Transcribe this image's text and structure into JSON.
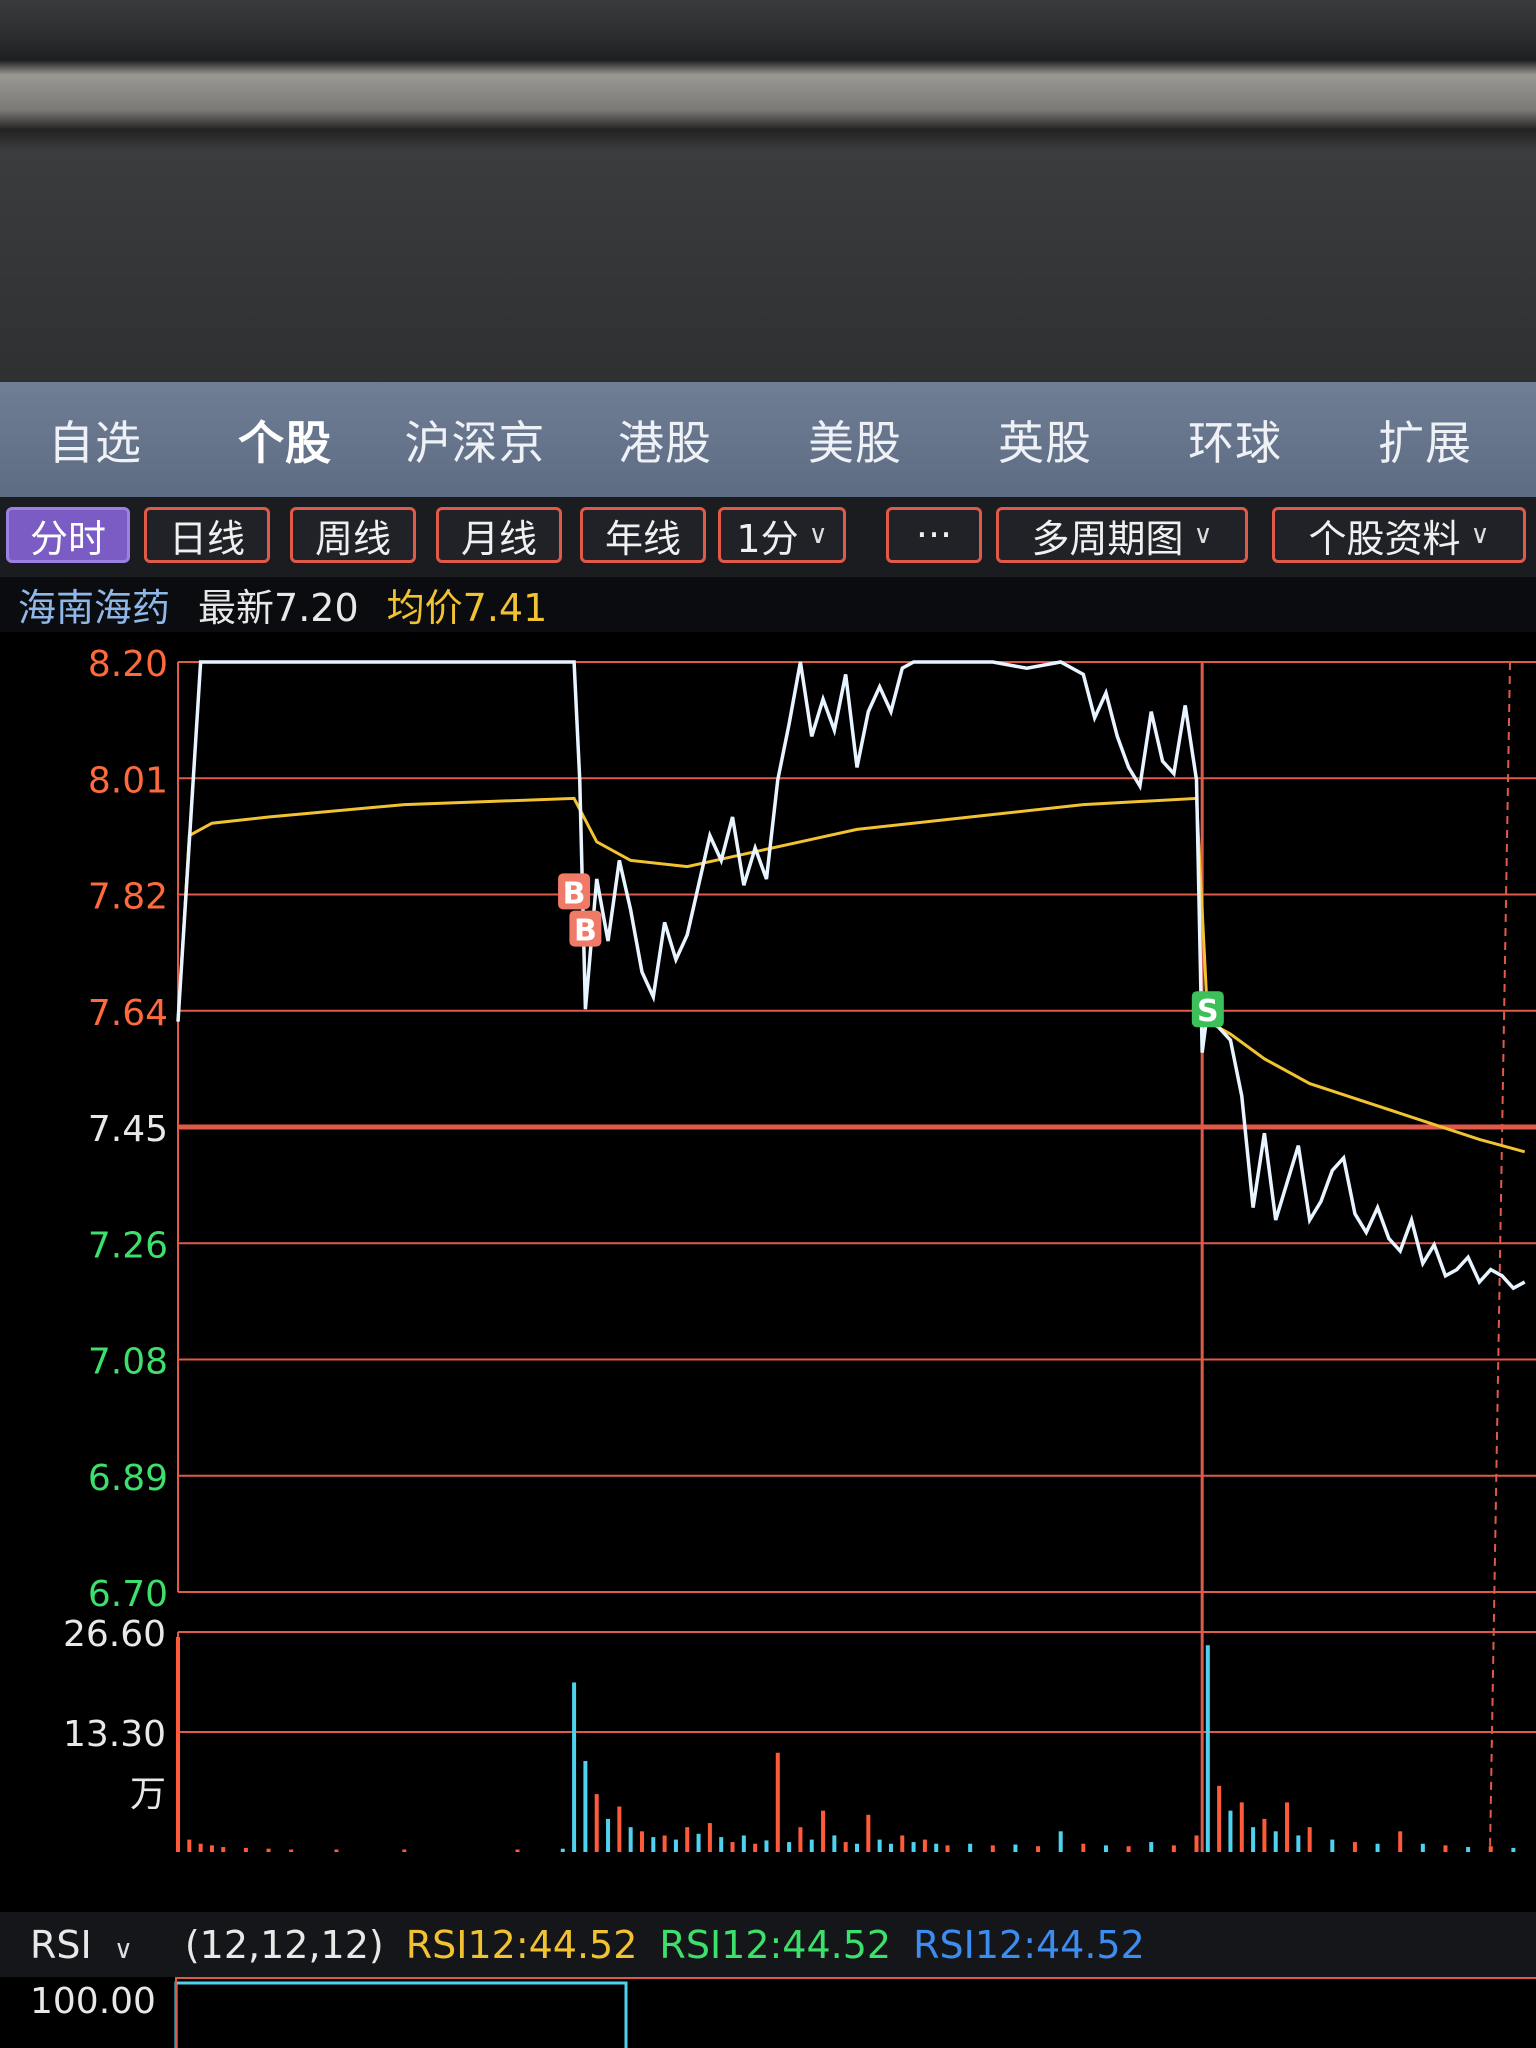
{
  "nav": {
    "tabs": [
      "自选",
      "个股",
      "沪深京",
      "港股",
      "美股",
      "英股",
      "环球",
      "扩展"
    ],
    "active_index": 1
  },
  "toolbar": {
    "buttons": [
      "分时",
      "日线",
      "周线",
      "月线",
      "年线",
      "1分",
      "···",
      "多周期图",
      "个股资料"
    ],
    "active_index": 0
  },
  "info": {
    "name": "海南海药",
    "latest": "最新7.20",
    "avg": "均价7.41"
  },
  "colors": {
    "up": "#ff6a3d",
    "down": "#3de06a",
    "price_line": "#e8f4ff",
    "avg_line": "#f1c232",
    "grid": "#e05a4a",
    "vol_up": "#ff5a3a",
    "vol_down": "#4fd2f0"
  },
  "chart_data": {
    "type": "line",
    "price_axis": {
      "ticks": [
        "8.20",
        "8.01",
        "7.82",
        "7.64",
        "7.45",
        "7.26",
        "7.08",
        "6.89",
        "6.70"
      ],
      "ylim": [
        6.7,
        8.2
      ]
    },
    "volume_axis": {
      "ticks": [
        "26.60",
        "13.30",
        "万"
      ],
      "ylim": [
        0,
        26.6
      ]
    },
    "series": [
      {
        "x": [
          0,
          2,
          4,
          6,
          18,
          35,
          35.5,
          36,
          37,
          38,
          39,
          40,
          41,
          42,
          43,
          44,
          45,
          46,
          47,
          48,
          49,
          50,
          51,
          52,
          53,
          54,
          55,
          56,
          57,
          58,
          59,
          60,
          61,
          62,
          63,
          64,
          65,
          66,
          67,
          68,
          69,
          70,
          72,
          75,
          78,
          80,
          81,
          82,
          83,
          84,
          85,
          86,
          87,
          88,
          89,
          90,
          90.5,
          91,
          92,
          93,
          94,
          95,
          96,
          97,
          98,
          99,
          100,
          101,
          102,
          103,
          104,
          105,
          106,
          107,
          108,
          109,
          110,
          111,
          112,
          113,
          114,
          115,
          116,
          117,
          118,
          119
        ],
        "values": [
          7.62,
          8.2,
          8.2,
          8.2,
          8.2,
          8.2,
          8.01,
          7.64,
          7.85,
          7.75,
          7.88,
          7.8,
          7.7,
          7.66,
          7.78,
          7.72,
          7.76,
          7.84,
          7.92,
          7.88,
          7.95,
          7.84,
          7.9,
          7.85,
          8.01,
          8.1,
          8.2,
          8.08,
          8.14,
          8.09,
          8.18,
          8.03,
          8.12,
          8.16,
          8.12,
          8.19,
          8.2,
          8.2,
          8.2,
          8.2,
          8.2,
          8.2,
          8.2,
          8.19,
          8.2,
          8.18,
          8.11,
          8.15,
          8.08,
          8.03,
          8.0,
          8.12,
          8.04,
          8.02,
          8.13,
          8.01,
          7.57,
          7.64,
          7.61,
          7.59,
          7.5,
          7.32,
          7.44,
          7.3,
          7.36,
          7.42,
          7.3,
          7.33,
          7.38,
          7.4,
          7.31,
          7.28,
          7.32,
          7.27,
          7.25,
          7.3,
          7.23,
          7.26,
          7.21,
          7.22,
          7.24,
          7.2,
          7.22,
          7.21,
          7.19,
          7.2
        ]
      },
      {
        "x": [
          0,
          1,
          3,
          8,
          20,
          35,
          37,
          40,
          45,
          50,
          55,
          60,
          70,
          80,
          90,
          91,
          93,
          96,
          100,
          105,
          110,
          115,
          119
        ],
        "values": [
          7.62,
          7.92,
          7.94,
          7.95,
          7.97,
          7.98,
          7.91,
          7.88,
          7.87,
          7.89,
          7.91,
          7.93,
          7.95,
          7.97,
          7.98,
          7.62,
          7.6,
          7.56,
          7.52,
          7.49,
          7.46,
          7.43,
          7.41
        ]
      }
    ],
    "markers": [
      {
        "label": "B",
        "x": 35,
        "value": 7.83,
        "color": "#f07a68"
      },
      {
        "label": "B",
        "x": 36,
        "value": 7.77,
        "color": "#f07a68"
      },
      {
        "label": "S",
        "x": 91,
        "value": 7.64,
        "color": "#3dbf5a"
      }
    ],
    "volume": {
      "x": [
        0,
        1,
        2,
        3,
        4,
        6,
        8,
        10,
        14,
        20,
        30,
        34,
        35,
        36,
        37,
        38,
        39,
        40,
        41,
        42,
        43,
        44,
        45,
        46,
        47,
        48,
        49,
        50,
        51,
        52,
        53,
        54,
        55,
        56,
        57,
        58,
        59,
        60,
        61,
        62,
        63,
        64,
        65,
        66,
        67,
        68,
        70,
        72,
        74,
        76,
        78,
        80,
        82,
        84,
        86,
        88,
        90,
        91,
        92,
        93,
        94,
        95,
        96,
        97,
        98,
        99,
        100,
        102,
        104,
        106,
        108,
        110,
        112,
        114,
        116,
        118
      ],
      "values": [
        26.0,
        1.5,
        1.0,
        0.8,
        0.6,
        0.5,
        0.4,
        0.3,
        0.3,
        0.3,
        0.3,
        0.4,
        20.5,
        11.0,
        7.0,
        4.0,
        5.5,
        3.0,
        2.5,
        1.8,
        2.0,
        1.5,
        3.0,
        2.2,
        3.5,
        1.8,
        1.2,
        2.0,
        1.0,
        1.4,
        12.0,
        1.2,
        3.0,
        1.5,
        5.0,
        2.0,
        1.2,
        1.0,
        4.5,
        1.5,
        1.0,
        2.0,
        1.2,
        1.5,
        1.0,
        0.8,
        1.0,
        0.8,
        0.9,
        0.7,
        2.5,
        1.0,
        0.8,
        0.7,
        1.2,
        0.8,
        2.0,
        25.0,
        8.0,
        5.0,
        6.0,
        3.0,
        4.0,
        2.5,
        6.0,
        2.0,
        3.0,
        1.5,
        1.2,
        1.0,
        2.5,
        1.0,
        0.8,
        0.6,
        0.7,
        0.5
      ],
      "up": [
        true,
        true,
        true,
        true,
        true,
        true,
        true,
        true,
        true,
        true,
        true,
        false,
        false,
        false,
        true,
        false,
        true,
        false,
        true,
        false,
        true,
        false,
        true,
        false,
        true,
        false,
        true,
        false,
        true,
        false,
        true,
        false,
        true,
        false,
        true,
        false,
        true,
        false,
        true,
        false,
        false,
        true,
        false,
        true,
        false,
        true,
        false,
        true,
        false,
        true,
        false,
        true,
        false,
        true,
        false,
        true,
        true,
        false,
        true,
        false,
        true,
        false,
        true,
        false,
        true,
        false,
        true,
        false,
        true,
        false,
        true,
        false,
        true,
        false,
        true,
        false
      ]
    },
    "session_split_x": 90.5,
    "prev_close_value": 7.45
  },
  "rsi": {
    "selector": "RSI",
    "params": "(12,12,12)",
    "r1": "RSI12:44.52",
    "r2": "RSI12:44.52",
    "r3": "RSI12:44.52",
    "axis_top": "100.00"
  }
}
